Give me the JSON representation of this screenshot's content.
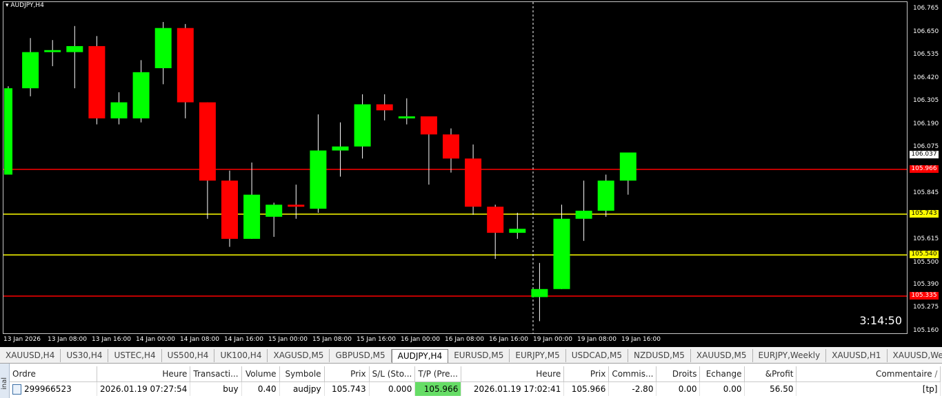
{
  "chart": {
    "symbol_title": "AUDJPY,H4",
    "countdown": "3:14:50",
    "colors": {
      "background": "#000000",
      "bull": "#00ff00",
      "bear": "#ff0000",
      "wick": "#ffffff",
      "red_line": "#ff0000",
      "yellow_line": "#ffff00"
    },
    "price_axis": [
      "106.765",
      "106.650",
      "106.535",
      "106.420",
      "106.305",
      "106.190",
      "106.075",
      "105.960",
      "105.845",
      "105.730",
      "105.615",
      "105.500",
      "105.390",
      "105.275",
      "105.160"
    ],
    "time_axis": [
      "13 Jan 2026",
      "13 Jan 08:00",
      "13 Jan 16:00",
      "14 Jan 00:00",
      "14 Jan 08:00",
      "14 Jan 16:00",
      "15 Jan 00:00",
      "15 Jan 08:00",
      "15 Jan 16:00",
      "16 Jan 00:00",
      "16 Jan 08:00",
      "16 Jan 16:00",
      "19 Jan 00:00",
      "19 Jan 08:00",
      "19 Jan 16:00"
    ],
    "levels": [
      {
        "label": "105.966",
        "color": "red"
      },
      {
        "label": "105.743",
        "color": "yellow"
      },
      {
        "label": "105.540",
        "color": "yellow"
      },
      {
        "label": "105.335",
        "color": "red"
      }
    ],
    "current_price": "106.037"
  },
  "chart_data": {
    "type": "candlestick",
    "title": "AUDJPY,H4",
    "ylim": [
      105.16,
      106.765
    ],
    "candles": [
      {
        "o": 105.94,
        "h": 106.38,
        "l": 105.94,
        "c": 106.37
      },
      {
        "o": 106.37,
        "h": 106.62,
        "l": 106.33,
        "c": 106.55
      },
      {
        "o": 106.55,
        "h": 106.61,
        "l": 106.48,
        "c": 106.56
      },
      {
        "o": 106.55,
        "h": 106.68,
        "l": 106.37,
        "c": 106.58
      },
      {
        "o": 106.58,
        "h": 106.63,
        "l": 106.19,
        "c": 106.22
      },
      {
        "o": 106.22,
        "h": 106.35,
        "l": 106.19,
        "c": 106.3
      },
      {
        "o": 106.22,
        "h": 106.51,
        "l": 106.2,
        "c": 106.45
      },
      {
        "o": 106.47,
        "h": 106.7,
        "l": 106.39,
        "c": 106.67
      },
      {
        "o": 106.67,
        "h": 106.69,
        "l": 106.22,
        "c": 106.3
      },
      {
        "o": 106.3,
        "h": 106.3,
        "l": 105.72,
        "c": 105.91
      },
      {
        "o": 105.91,
        "h": 105.96,
        "l": 105.58,
        "c": 105.62
      },
      {
        "o": 105.62,
        "h": 106.0,
        "l": 105.62,
        "c": 105.84
      },
      {
        "o": 105.73,
        "h": 105.8,
        "l": 105.63,
        "c": 105.79
      },
      {
        "o": 105.79,
        "h": 105.89,
        "l": 105.72,
        "c": 105.78
      },
      {
        "o": 105.77,
        "h": 106.24,
        "l": 105.75,
        "c": 106.06
      },
      {
        "o": 106.06,
        "h": 106.2,
        "l": 105.93,
        "c": 106.08
      },
      {
        "o": 106.08,
        "h": 106.34,
        "l": 106.02,
        "c": 106.29
      },
      {
        "o": 106.29,
        "h": 106.34,
        "l": 106.21,
        "c": 106.26
      },
      {
        "o": 106.22,
        "h": 106.32,
        "l": 106.19,
        "c": 106.23
      },
      {
        "o": 106.23,
        "h": 106.23,
        "l": 105.89,
        "c": 106.14
      },
      {
        "o": 106.14,
        "h": 106.17,
        "l": 105.95,
        "c": 106.02
      },
      {
        "o": 106.02,
        "h": 106.09,
        "l": 105.74,
        "c": 105.78
      },
      {
        "o": 105.78,
        "h": 105.79,
        "l": 105.52,
        "c": 105.65
      },
      {
        "o": 105.65,
        "h": 105.75,
        "l": 105.62,
        "c": 105.67
      },
      {
        "o": 105.33,
        "h": 105.5,
        "l": 105.21,
        "c": 105.37
      },
      {
        "o": 105.37,
        "h": 105.79,
        "l": 105.37,
        "c": 105.72
      },
      {
        "o": 105.72,
        "h": 105.91,
        "l": 105.61,
        "c": 105.76
      },
      {
        "o": 105.76,
        "h": 105.94,
        "l": 105.73,
        "c": 105.91
      },
      {
        "o": 105.91,
        "h": 106.05,
        "l": 105.84,
        "c": 106.05
      }
    ]
  },
  "tabs": [
    "XAUUSD,H4",
    "US30,H4",
    "USTEC,H4",
    "US500,H4",
    "UK100,H4",
    "XAGUSD,M5",
    "GBPUSD,M5",
    "AUDJPY,H4",
    "EURUSD,M5",
    "EURJPY,M5",
    "USDCAD,M5",
    "NZDUSD,M5",
    "XAUUSD,M5",
    "EURJPY,Weekly",
    "XAUUSD,H1",
    "XAUUSD,We"
  ],
  "active_tab": "AUDJPY,H4",
  "terminal": {
    "side_label": "inal",
    "columns": [
      "Ordre",
      "Heure",
      "Transacti...",
      "Volume",
      "Symbole",
      "Prix",
      "S/L (Sto...",
      "T/P (Pre...",
      "Heure",
      "Prix",
      "Commis...",
      "Droits",
      "Echange",
      "&Profit",
      "Commentaire"
    ],
    "sort_indicator": "/",
    "row": {
      "order": "299966523",
      "time_open": "2026.01.19 07:27:54",
      "type": "buy",
      "volume": "0.40",
      "symbol": "audjpy",
      "price_open": "105.743",
      "sl": "0.000",
      "tp": "105.966",
      "time_close": "2026.01.19 17:02:41",
      "price_close": "105.966",
      "commission": "-2.80",
      "swap_rights": "0.00",
      "exchange": "0.00",
      "profit": "56.50",
      "comment": "[tp]"
    }
  }
}
